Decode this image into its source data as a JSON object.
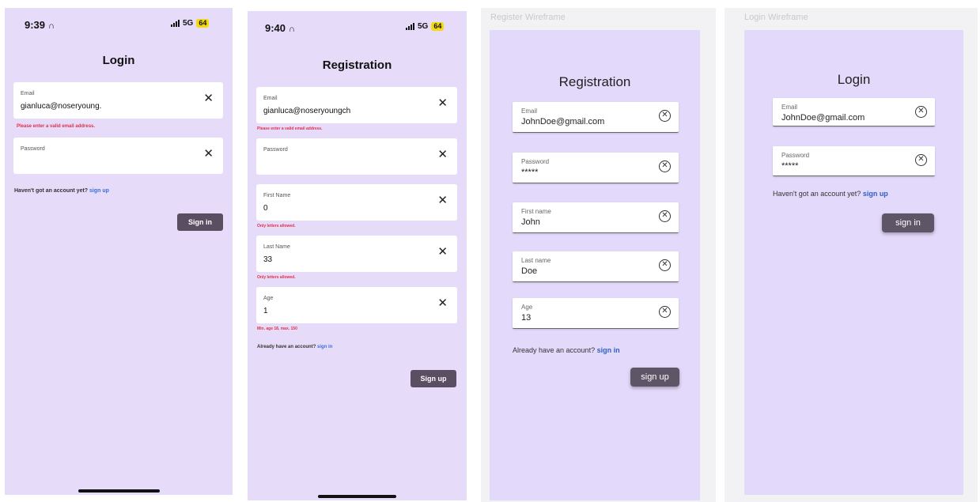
{
  "icons": {
    "clear": "close-icon",
    "clear_circle": "circle-x-icon",
    "headphones": "headphones-icon",
    "signal": "signal-icon"
  },
  "colors": {
    "screen_bg": "#e6dcfa",
    "button_bg": "#5a4e63",
    "link": "#3a6fd8",
    "error": "#e0304a",
    "battery": "#f5d90a"
  },
  "phone_login": {
    "status": {
      "time": "9:39",
      "network": "5G",
      "battery": "64"
    },
    "title": "Login",
    "email": {
      "label": "Email",
      "value": "gianluca@noseryoung.",
      "error": "Please enter a valid email address."
    },
    "password": {
      "label": "Password",
      "value": ""
    },
    "signup_prompt": "Haven't got an account yet?",
    "signup_link": "sign up",
    "submit": "Sign in"
  },
  "phone_register": {
    "status": {
      "time": "9:40",
      "network": "5G",
      "battery": "64"
    },
    "title": "Registration",
    "email": {
      "label": "Email",
      "value": "gianluca@noseryoungch",
      "error": "Please enter a valid email address."
    },
    "password": {
      "label": "Password",
      "value": ""
    },
    "first_name": {
      "label": "First Name",
      "value": "0",
      "error": "Only letters allowed."
    },
    "last_name": {
      "label": "Last Name",
      "value": "33",
      "error": "Only letters allowed."
    },
    "age": {
      "label": "Age",
      "value": "1",
      "error": "Min. age 18, max. 150"
    },
    "signin_prompt": "Already have an account?",
    "signin_link": "sign in",
    "submit": "Sign up"
  },
  "wire_register": {
    "caption": "Register Wireframe",
    "title": "Registration",
    "email": {
      "label": "Email",
      "value": "JohnDoe@gmail.com"
    },
    "password": {
      "label": "Password",
      "value": "*****"
    },
    "first_name": {
      "label": "First name",
      "value": "John"
    },
    "last_name": {
      "label": "Last name",
      "value": "Doe"
    },
    "age": {
      "label": "Age",
      "value": "13"
    },
    "signin_prompt": "Already have an account?",
    "signin_link": "sign in",
    "submit": "sign up"
  },
  "wire_login": {
    "caption": "Login Wireframe",
    "title": "Login",
    "email": {
      "label": "Email",
      "value": "JohnDoe@gmail.com"
    },
    "password": {
      "label": "Password",
      "value": "*****"
    },
    "signup_prompt": "Haven't got an account yet?",
    "signup_link": "sign up",
    "submit": "sign in"
  }
}
